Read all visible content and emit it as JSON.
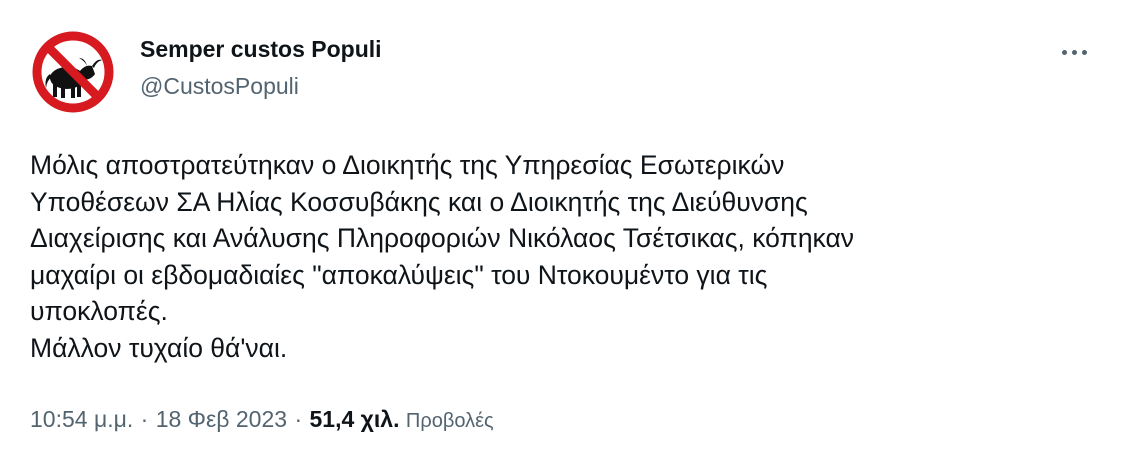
{
  "author": {
    "display_name": "Semper custos Populi",
    "handle": "@CustosPopuli",
    "avatar_icon": "no-bull-sign-icon"
  },
  "menu": {
    "icon": "more-options-icon"
  },
  "tweet": {
    "lines": [
      "Μόλις αποστρατεύτηκαν ο Διοικητής της Υπηρεσίας Εσωτερικών",
      "Υποθέσεων ΣΑ Ηλίας Κοσσυβάκης και ο Διοικητής της Διεύθυνσης",
      "Διαχείρισης και Ανάλυσης Πληροφοριών Νικόλαος Τσέτσικας, κόπηκαν",
      "μαχαίρι οι εβδομαδιαίες \"αποκαλύψεις\" του Ντοκουμέντο για τις",
      "υποκλοπές.",
      "Μάλλον τυχαίο θά'ναι."
    ]
  },
  "meta": {
    "time": "10:54 μ.μ.",
    "separator": "·",
    "date": "18 Φεβ 2023",
    "views_count": "51,4 χιλ.",
    "views_label": "Προβολές"
  },
  "colors": {
    "text_primary": "#0f1419",
    "text_secondary": "#536471",
    "prohibition_red": "#d71920"
  }
}
